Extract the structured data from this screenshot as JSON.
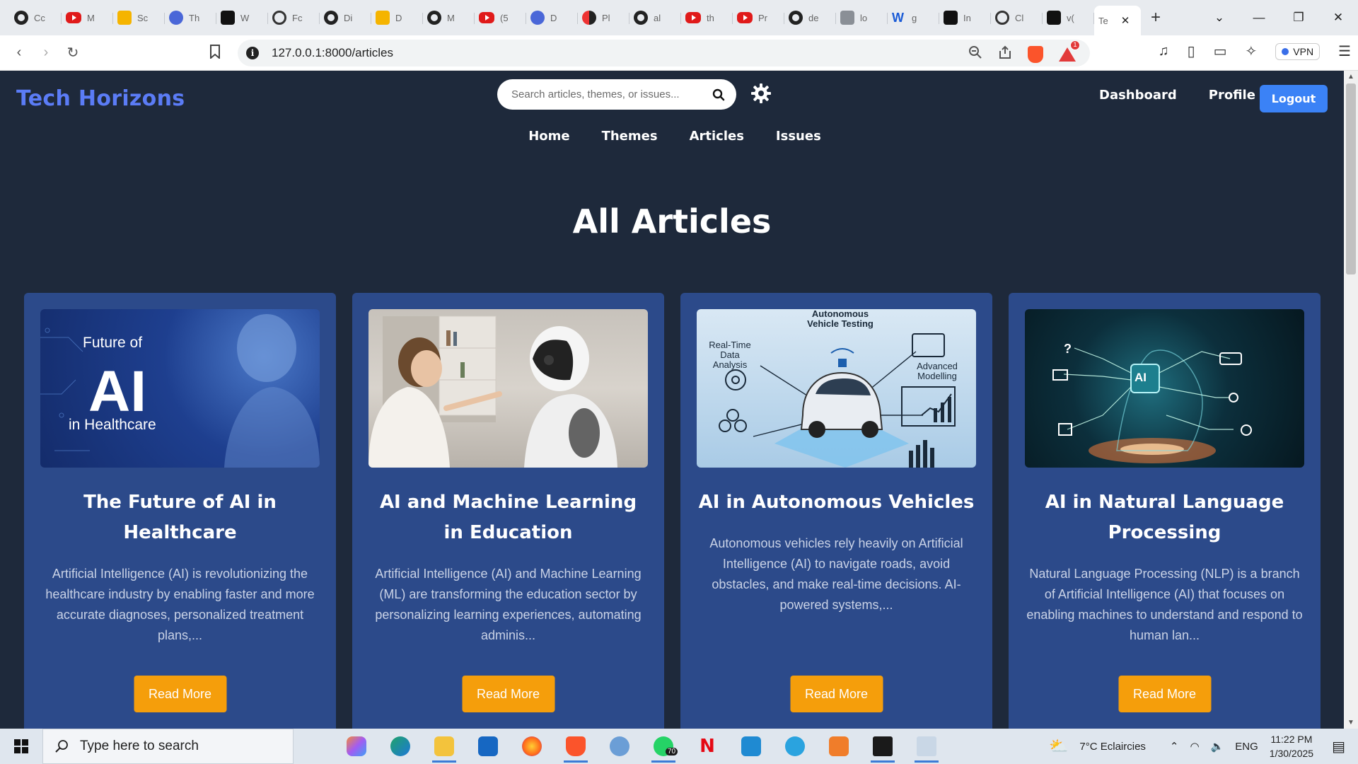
{
  "browser": {
    "tabs": [
      {
        "icon": "github-icon",
        "label": "Cc"
      },
      {
        "icon": "youtube-icon",
        "label": "M"
      },
      {
        "icon": "sc-icon",
        "label": "Sc"
      },
      {
        "icon": "power-icon",
        "label": "Th"
      },
      {
        "icon": "m-icon",
        "label": "W"
      },
      {
        "icon": "chatgpt-icon",
        "label": "Fc"
      },
      {
        "icon": "github-icon",
        "label": "Di"
      },
      {
        "icon": "drive-icon",
        "label": "D"
      },
      {
        "icon": "github-icon",
        "label": "M"
      },
      {
        "icon": "youtube-icon",
        "label": "(5"
      },
      {
        "icon": "deepseek-icon",
        "label": "D"
      },
      {
        "icon": "pl-icon",
        "label": "Pl"
      },
      {
        "icon": "github-icon",
        "label": "al"
      },
      {
        "icon": "youtube-icon",
        "label": "th"
      },
      {
        "icon": "youtube-icon",
        "label": "Pr"
      },
      {
        "icon": "github-icon",
        "label": "de"
      },
      {
        "icon": "mountain-icon",
        "label": "lo"
      },
      {
        "icon": "word-icon",
        "label": "g"
      },
      {
        "icon": "chatgpt-icon",
        "label": "In"
      },
      {
        "icon": "chatgpt-icon",
        "label": "Cl"
      },
      {
        "icon": "v0-icon",
        "label": "v("
      }
    ],
    "active_tab_label": "Te",
    "url": "127.0.0.1:8000/articles",
    "notification_count": "1",
    "vpn_label": "VPN"
  },
  "header": {
    "brand": "Tech Horizons",
    "search_placeholder": "Search articles, themes, or issues...",
    "links": [
      "Dashboard",
      "Profile"
    ],
    "logout": "Logout",
    "nav": [
      "Home",
      "Themes",
      "Articles",
      "Issues"
    ]
  },
  "page": {
    "title": "All Articles"
  },
  "articles": [
    {
      "title": "The Future of AI in Healthcare",
      "excerpt": "Artificial Intelligence (AI) is revolutionizing the healthcare industry by enabling faster and more accurate diagnoses, personalized treatment plans,...",
      "button": "Read More",
      "image_text": [
        "Future of",
        "AI",
        "in Healthcare"
      ]
    },
    {
      "title": "AI and Machine Learning in Education",
      "excerpt": "Artificial Intelligence (AI) and Machine Learning (ML) are transforming the education sector by personalizing learning experiences, automating adminis...",
      "button": "Read More"
    },
    {
      "title": "AI in Autonomous Vehicles",
      "excerpt": "Autonomous vehicles rely heavily on Artificial Intelligence (AI) to navigate roads, avoid obstacles, and make real-time decisions. AI-powered systems,...",
      "button": "Read More",
      "image_text": [
        "Autonomous Vehicle Testing",
        "Real-Time Data Analysis",
        "Advanced Modelling"
      ]
    },
    {
      "title": "AI in Natural Language Processing",
      "excerpt": "Natural Language Processing (NLP) is a branch of Artificial Intelligence (AI) that focuses on enabling machines to understand and respond to human lan...",
      "button": "Read More",
      "image_text": [
        "AI"
      ]
    }
  ],
  "taskbar": {
    "search_text": "Type here to search",
    "weather": "7°C  Eclaircies",
    "language": "ENG",
    "time": "11:22 PM",
    "date": "1/30/2025",
    "whatsapp_badge": "70"
  },
  "colors": {
    "page_bg": "#1e293b",
    "card_bg": "#2c4a8a",
    "brand": "#5b7cf6",
    "logout_bg": "#3b82f6",
    "read_more_bg": "#f59e0b"
  }
}
